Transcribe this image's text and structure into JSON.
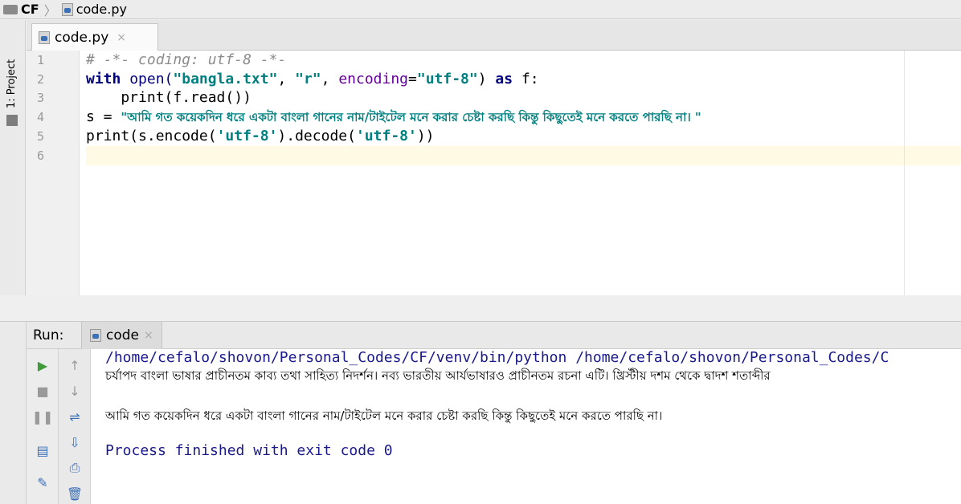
{
  "breadcrumb": {
    "project": "CF",
    "file": "code.py"
  },
  "left_tool": {
    "project_tab": "1: Project"
  },
  "editor": {
    "tab": {
      "label": "code.py",
      "close": "×"
    },
    "line_numbers": [
      "1",
      "2",
      "3",
      "4",
      "5",
      "6"
    ],
    "lines": {
      "l1": "# -*- coding: utf-8 -*-",
      "l2_kw_with": "with",
      "l2_open": " open(",
      "l2_str1": "\"bangla.txt\"",
      "l2_comma1": ", ",
      "l2_str2": "\"r\"",
      "l2_comma2": ", ",
      "l2_param": "encoding",
      "l2_eq": "=",
      "l2_str3": "\"utf-8\"",
      "l2_close": ") ",
      "l2_kw_as": "as",
      "l2_end": " f:",
      "l3": "    print(f.read())",
      "l4_head": "s = ",
      "l4_str": "\"আমি গত কয়েকদিন ধরে একটা বাংলা গানের নাম/টাইটেল মনে করার চেষ্টা করছি কিন্তু কিছুতেই মনে করতে পারছি না। \"",
      "l5_head": "print(s.encode(",
      "l5_str1": "'utf-8'",
      "l5_mid": ").decode(",
      "l5_str2": "'utf-8'",
      "l5_end": "))"
    }
  },
  "run": {
    "label": "Run:",
    "tab_label": "code",
    "tab_close": "×",
    "output": {
      "path": "/home/cefalo/shovon/Personal_Codes/CF/venv/bin/python /home/cefalo/shovon/Personal_Codes/C",
      "bn1": "চর্যাপদ বাংলা ভাষার প্রাচীনতম কাব্য তথা সাহিত্য নিদর্শন। নব্য ভারতীয় আর্যভাষারও প্রাচীনতম রচনা এটি। খ্রিস্টীয় দশম থেকে দ্বাদশ শতাব্দীর",
      "bn2": "আমি গত কয়েকদিন ধরে একটা বাংলা গানের নাম/টাইটেল মনে করার চেষ্টা করছি কিন্তু কিছুতেই মনে করতে পারছি না।",
      "exit": "Process finished with exit code 0"
    }
  }
}
